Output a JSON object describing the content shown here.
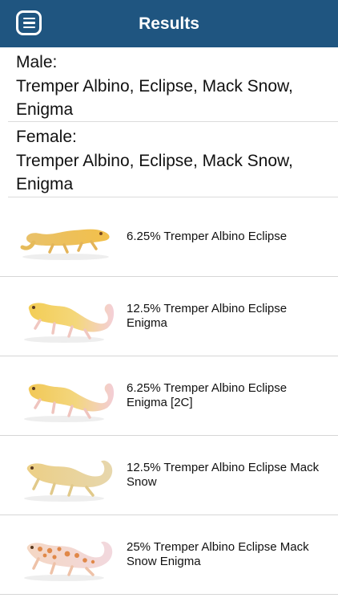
{
  "nav": {
    "title": "Results",
    "menu_icon": "menu-icon"
  },
  "male": {
    "heading": "Male:",
    "traits": "Tremper Albino, Eclipse, Mack Snow, Enigma"
  },
  "female": {
    "heading": "Female:",
    "traits": "Tremper Albino, Eclipse, Mack Snow, Enigma"
  },
  "results": [
    {
      "label": "6.25% Tremper Albino Eclipse"
    },
    {
      "label": "12.5% Tremper Albino Eclipse Enigma"
    },
    {
      "label": "6.25% Tremper Albino Eclipse Enigma [2C]"
    },
    {
      "label": "12.5% Tremper Albino Eclipse Mack Snow"
    },
    {
      "label": "25% Tremper Albino Eclipse Mack Snow Enigma"
    }
  ],
  "colors": {
    "nav_bg": "#1f5580",
    "nav_text": "#ffffff",
    "separator": "#d6d6d6"
  }
}
